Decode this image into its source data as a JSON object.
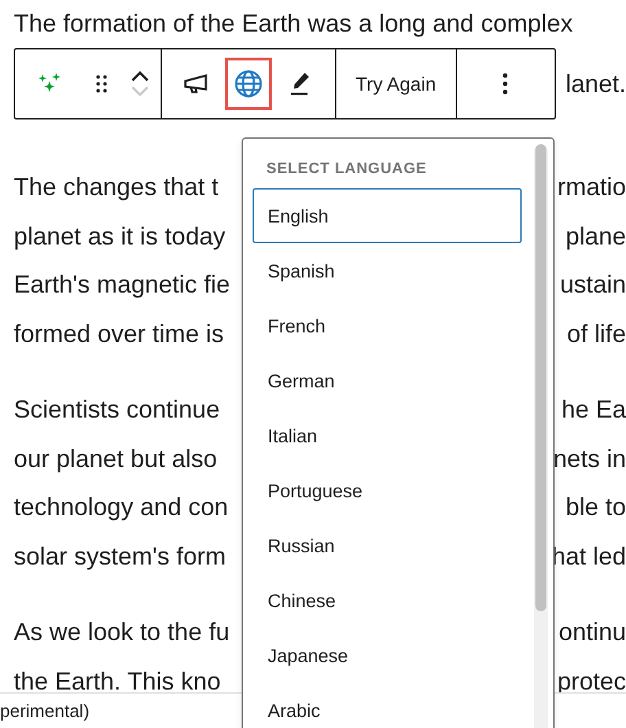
{
  "paragraphs": [
    {
      "lines": [
        {
          "left": "The formation of the Earth was a long and complex"
        },
        {
          "right": "lanet."
        }
      ]
    },
    {
      "lines": [
        {
          "left": "The changes that t",
          "right": "rmatio"
        },
        {
          "left": "planet as it is today",
          "right": "plane"
        },
        {
          "left": "Earth's magnetic fie",
          "right": "ustain"
        },
        {
          "left": "formed over time is",
          "right": "of life"
        }
      ]
    },
    {
      "lines": [
        {
          "left": "Scientists continue",
          "right": "he Ea"
        },
        {
          "left": "our planet but also",
          "right": "nets in"
        },
        {
          "left": "technology and con",
          "right": "ble to"
        },
        {
          "left": "solar system's form",
          "right": "hat led"
        }
      ]
    },
    {
      "lines": [
        {
          "left": "As we look to the fu",
          "right": "ontinu"
        },
        {
          "left": "the Earth. This kno",
          "right": "protec"
        }
      ]
    }
  ],
  "toolbar": {
    "groups": [
      [
        {
          "kind": "sparkle"
        },
        {
          "kind": "drag"
        },
        {
          "kind": "mover",
          "down_disabled": true
        }
      ],
      [
        {
          "kind": "megaphone"
        },
        {
          "kind": "globe",
          "highlighted": true
        },
        {
          "kind": "pen"
        }
      ],
      [
        {
          "kind": "text",
          "label": "Try Again"
        }
      ],
      [
        {
          "kind": "more"
        }
      ]
    ]
  },
  "dropdown": {
    "heading": "SELECT LANGUAGE",
    "options": [
      {
        "label": "English",
        "selected": true
      },
      {
        "label": "Spanish",
        "selected": false
      },
      {
        "label": "French",
        "selected": false
      },
      {
        "label": "German",
        "selected": false
      },
      {
        "label": "Italian",
        "selected": false
      },
      {
        "label": "Portuguese",
        "selected": false
      },
      {
        "label": "Russian",
        "selected": false
      },
      {
        "label": "Chinese",
        "selected": false
      },
      {
        "label": "Japanese",
        "selected": false
      },
      {
        "label": "Arabic",
        "selected": false
      }
    ]
  },
  "status_bar": {
    "text": "perimental)"
  }
}
